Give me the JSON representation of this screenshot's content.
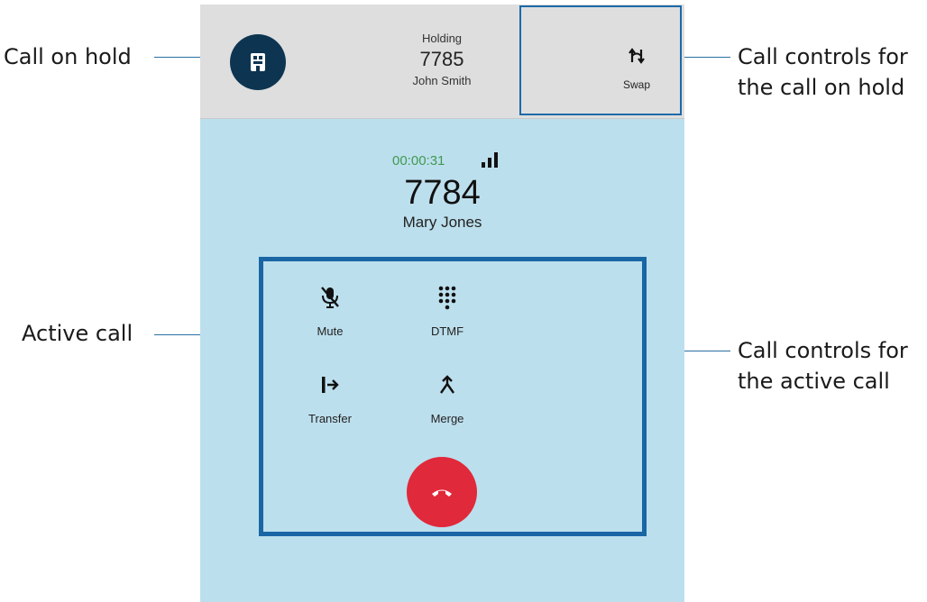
{
  "callouts": {
    "call_on_hold": "Call on hold",
    "active_call": "Active call",
    "hold_controls_line1": "Call controls for",
    "hold_controls_line2": "the call on hold",
    "active_controls_line1": "Call controls for",
    "active_controls_line2": "the active call"
  },
  "hold_call": {
    "status": "Holding",
    "number": "7785",
    "name": "John Smith",
    "swap_label": "Swap",
    "avatar_icon": "hold-building-icon"
  },
  "active_call": {
    "timer": "00:00:31",
    "number": "7784",
    "name": "Mary Jones",
    "signal_icon": "signal-bars-icon"
  },
  "controls": {
    "mute_label": "Mute",
    "dtmf_label": "DTMF",
    "transfer_label": "Transfer",
    "merge_label": "Merge",
    "hangup_icon": "hang-up-icon"
  },
  "colors": {
    "hold_bar": "#dedede",
    "active_bg": "#bcdfed",
    "avatar": "#0d3552",
    "highlight_border": "#1a66a5",
    "timer": "#3f9a51",
    "hangup": "#e0293a"
  }
}
